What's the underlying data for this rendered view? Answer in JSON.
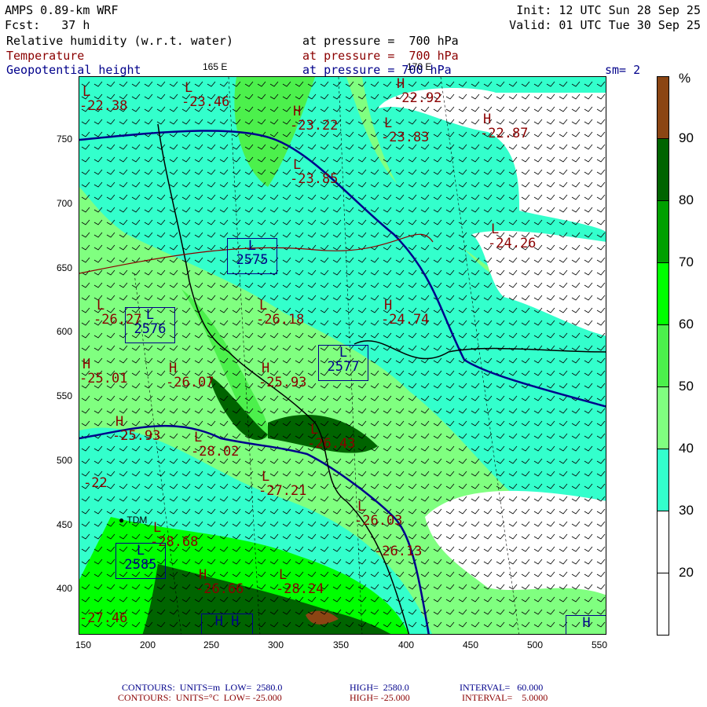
{
  "header": {
    "model": "AMPS 0.89-km WRF",
    "fcst": "Fcst:   37 h",
    "init": "Init: 12 UTC Sun 28 Sep 25",
    "valid": "Valid: 01 UTC Tue 30 Sep 25"
  },
  "fields": [
    {
      "name": "Relative humidity (w.r.t. water)",
      "level": "at pressure =  700 hPa"
    },
    {
      "name": "Temperature",
      "level": "at pressure =  700 hPa"
    },
    {
      "name": "Geopotential height",
      "level": "at pressure = 700 hPa"
    }
  ],
  "smoothing": "sm= 2",
  "lon_labels": [
    "165 E",
    "170 E"
  ],
  "x_ticks": [
    "150",
    "200",
    "250",
    "300",
    "350",
    "400",
    "450",
    "500",
    "550"
  ],
  "y_ticks": [
    "750",
    "700",
    "650",
    "600",
    "550",
    "500",
    "450",
    "400"
  ],
  "colorbar": {
    "unit": "%",
    "labels": [
      "90",
      "80",
      "70",
      "60",
      "50",
      "40",
      "30",
      "20"
    ],
    "colors": [
      "#8b4513",
      "#006400",
      "#00a000",
      "#00ff00",
      "#4cf04c",
      "#80ff80",
      "#33ffcc",
      "#ffffff",
      "#ffffff"
    ]
  },
  "station": "TDM",
  "temp_labels": [
    {
      "t": "L",
      "v": "-23.46"
    },
    {
      "t": "L",
      "v": "-22.38"
    },
    {
      "t": "H",
      "v": "-23.22"
    },
    {
      "t": "H",
      "v": "-22.92"
    },
    {
      "t": "L",
      "v": "-23.83"
    },
    {
      "t": "H",
      "v": "-22.87"
    },
    {
      "t": "L",
      "v": "-23.85"
    },
    {
      "t": "L",
      "v": "-24.26"
    },
    {
      "t": "L",
      "v": "-26.27"
    },
    {
      "t": "L",
      "v": "-26.18"
    },
    {
      "t": "H",
      "v": "-24.74"
    },
    {
      "t": "H",
      "v": "-25.01"
    },
    {
      "t": "H",
      "v": "-26.07"
    },
    {
      "t": "H",
      "v": "-25.93"
    },
    {
      "t": "H",
      "v": "-25.93"
    },
    {
      "t": "L",
      "v": "-28.02"
    },
    {
      "t": "L",
      "v": "-26.43"
    },
    {
      "t": "L",
      "v": "-27.21"
    },
    {
      "t": "",
      "v": "-22"
    },
    {
      "t": "L",
      "v": "-26.03"
    },
    {
      "t": "L",
      "v": "-28.68"
    },
    {
      "t": "",
      "v": "-26.13"
    },
    {
      "t": "H",
      "v": "-26.66"
    },
    {
      "t": "L",
      "v": "-28.24"
    },
    {
      "t": "",
      "v": "-27.46"
    }
  ],
  "height_boxes": [
    {
      "t": "L",
      "v": "2575"
    },
    {
      "t": "L",
      "v": "2576"
    },
    {
      "t": "L",
      "v": "2577"
    },
    {
      "t": "L",
      "v": "2585"
    },
    {
      "t": "H H",
      "v": ""
    },
    {
      "t": "H",
      "v": ""
    }
  ],
  "footer": {
    "line1": [
      "CONTOURS:  UNITS=m  LOW=  2580.0",
      "HIGH=  2580.0",
      "INTERVAL=   60.000"
    ],
    "line2": [
      "CONTOURS:  UNITS=°C  LOW= -25.000",
      "HIGH= -25.000",
      "INTERVAL=    5.0000"
    ]
  }
}
